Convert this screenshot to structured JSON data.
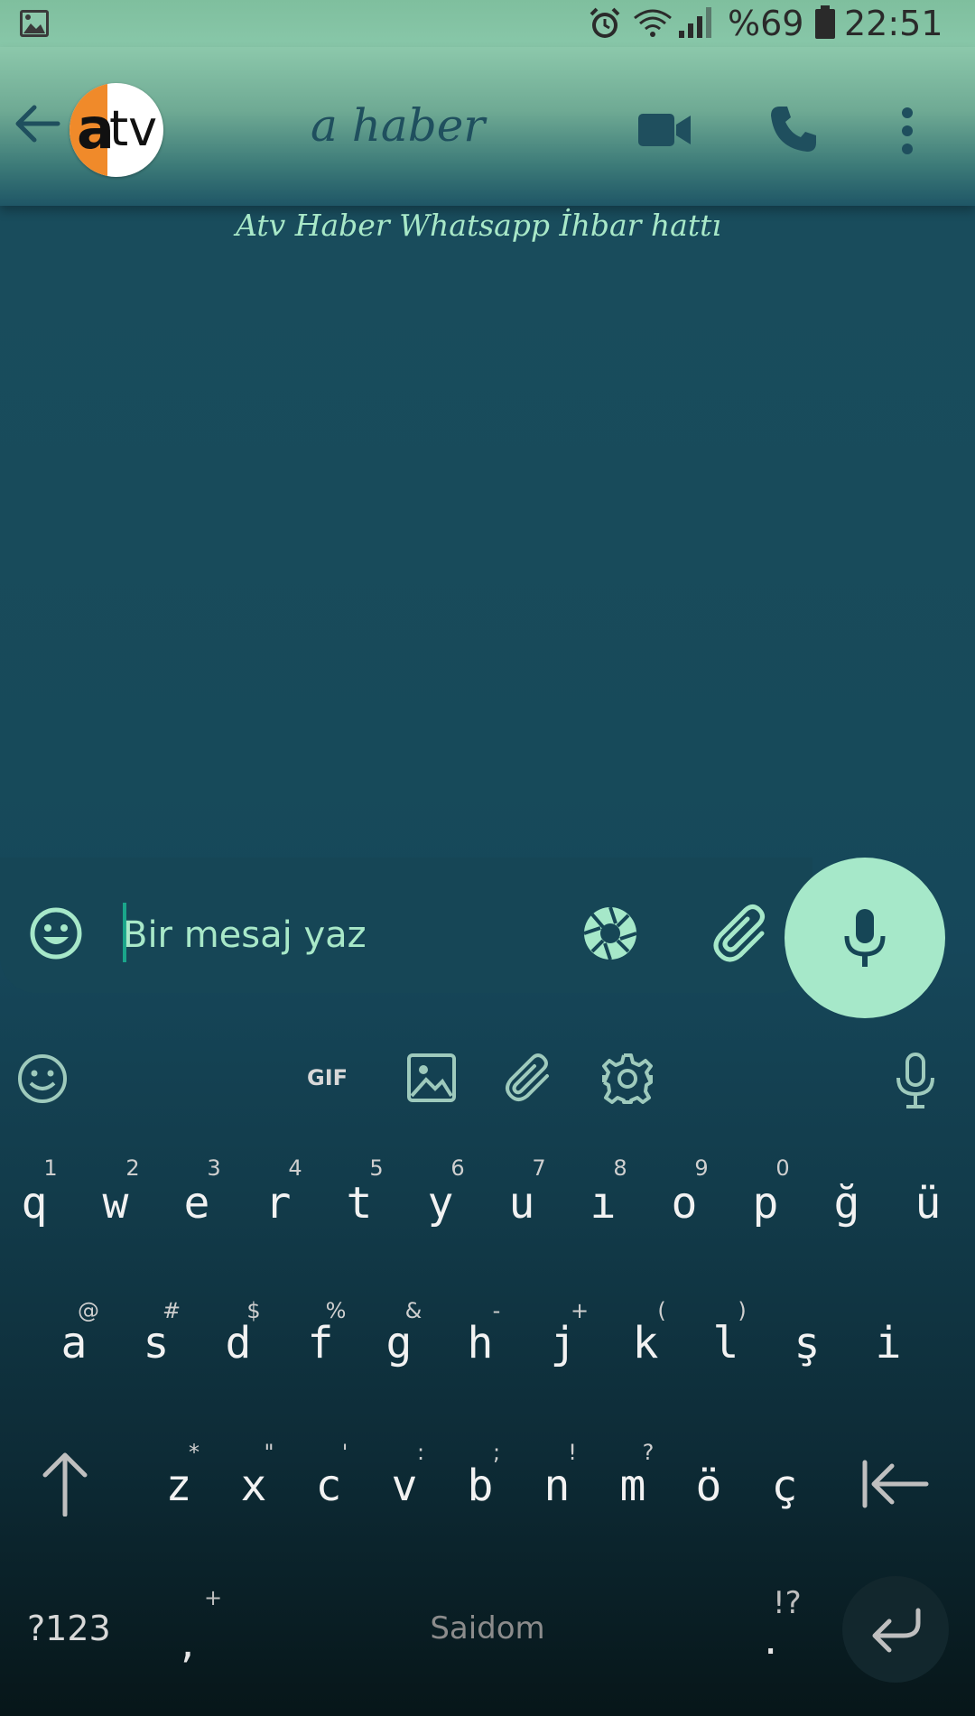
{
  "status_bar": {
    "battery": "%69",
    "time": "22:51",
    "icons": [
      "image-icon",
      "alarm-icon",
      "wifi-icon",
      "signal-icon",
      "battery-icon"
    ]
  },
  "header": {
    "title": "a haber",
    "subtitle": "Atv Haber Whatsapp İhbar hattı",
    "avatar_logo": {
      "a": "a",
      "tv": "tv"
    },
    "icons": [
      "back-arrow-icon",
      "video-call-icon",
      "phone-icon",
      "more-vert-icon"
    ]
  },
  "composer": {
    "placeholder": "Bir mesaj yaz",
    "icons": [
      "emoji-icon",
      "camera-icon",
      "attach-icon",
      "mic-icon"
    ]
  },
  "keyboard": {
    "toolbar": {
      "gif_label": "GIF",
      "icons": [
        "emoji-icon",
        "gif-icon",
        "image-icon",
        "attach-icon",
        "settings-icon",
        "mic-icon"
      ]
    },
    "row1": [
      {
        "k": "q",
        "h": "1"
      },
      {
        "k": "w",
        "h": "2"
      },
      {
        "k": "e",
        "h": "3"
      },
      {
        "k": "r",
        "h": "4"
      },
      {
        "k": "t",
        "h": "5"
      },
      {
        "k": "y",
        "h": "6"
      },
      {
        "k": "u",
        "h": "7"
      },
      {
        "k": "ı",
        "h": "8"
      },
      {
        "k": "o",
        "h": "9"
      },
      {
        "k": "p",
        "h": "0"
      },
      {
        "k": "ğ",
        "h": ""
      },
      {
        "k": "ü",
        "h": ""
      }
    ],
    "row2": [
      {
        "k": "a",
        "h": "@"
      },
      {
        "k": "s",
        "h": "#"
      },
      {
        "k": "d",
        "h": "$"
      },
      {
        "k": "f",
        "h": "%"
      },
      {
        "k": "g",
        "h": "&"
      },
      {
        "k": "h",
        "h": "-"
      },
      {
        "k": "j",
        "h": "+"
      },
      {
        "k": "k",
        "h": "("
      },
      {
        "k": "l",
        "h": ")"
      },
      {
        "k": "ş",
        "h": ""
      },
      {
        "k": "i",
        "h": ""
      }
    ],
    "row3": [
      {
        "k": "z",
        "h": "*"
      },
      {
        "k": "x",
        "h": "\""
      },
      {
        "k": "c",
        "h": "'"
      },
      {
        "k": "v",
        "h": ":"
      },
      {
        "k": "b",
        "h": ";"
      },
      {
        "k": "n",
        "h": "!"
      },
      {
        "k": "m",
        "h": "?"
      },
      {
        "k": "ö",
        "h": ""
      },
      {
        "k": "ç",
        "h": ""
      }
    ],
    "bottom": {
      "symbols": "?123",
      "comma": ",",
      "comma_hint": "+",
      "space": "Saidom",
      "period": ".",
      "period_hint": "!?"
    }
  },
  "colors": {
    "accent": "#a6e8c9",
    "header_top": "#8cc8ab",
    "chat_bg": "#17495a",
    "subtitle": "#a8e8c8"
  }
}
